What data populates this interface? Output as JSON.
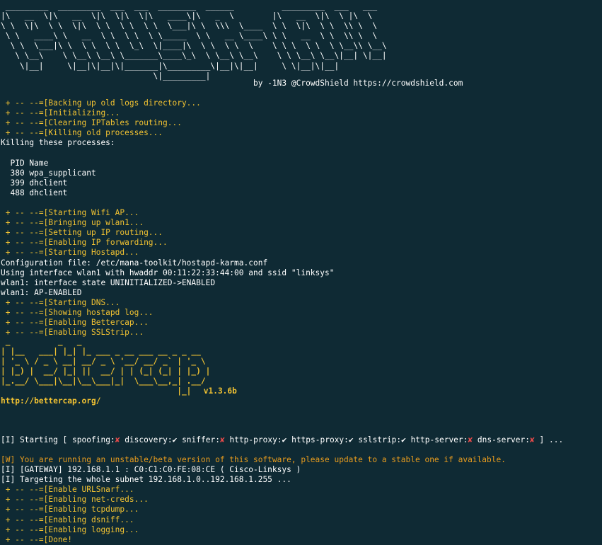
{
  "banner": [
    " _________  _________  ___  ___  ________  ______          _________  ___   ___",
    "|\\   __  \\|\\   __  \\|\\  \\|\\  \\|\\   ____\\|\\   _  \\        |\\   __  \\|\\  \\ |\\  \\",
    "\\ \\  \\|\\  \\ \\  \\|\\  \\ \\  \\ \\  \\ \\  \\___|\\ \\  \\\\\\  \\____  \\ \\  \\|\\  \\ \\  \\\\ \\  \\",
    " \\ \\   ____\\ \\   __  \\ \\  \\ \\  \\ \\_____  \\ \\   __ \\____\\ \\ \\   __  \\ \\  \\\\ \\  \\",
    "  \\ \\  \\___|\\ \\  \\ \\  \\ \\  \\_\\  \\|____|\\  \\ \\  \\ \\  \\    \\ \\ \\  \\ \\  \\ \\__\\\\ \\__\\",
    "   \\ \\__\\    \\ \\__\\ \\__\\ \\_______\\____\\_\\  \\ \\__\\ \\__\\    \\ \\ \\__\\ \\__\\|__| \\|__|",
    "    \\|__|     \\|__|\\|__|\\|_______|\\_________\\|__|\\|__|     \\ \\|__|\\|__|    ",
    "                                \\|_________|                  "
  ],
  "byline": "                                                     by -1N3 @CrowdShield https://crowdshield.com",
  "section1": [
    {
      "text": " + -- --=[Backing up old logs directory...",
      "style": "yellow"
    },
    {
      "text": " + -- --=[Initializing...",
      "style": "yellow"
    },
    {
      "text": " + -- --=[Clearing IPTables routing...",
      "style": "yellow"
    },
    {
      "text": " + -- --=[Killing old processes...",
      "style": "yellow"
    },
    {
      "text": "Killing these processes:",
      "style": "white"
    },
    {
      "text": "",
      "style": "white"
    },
    {
      "text": "  PID Name",
      "style": "white"
    },
    {
      "text": "  380 wpa_supplicant",
      "style": "white"
    },
    {
      "text": "  399 dhclient",
      "style": "white"
    },
    {
      "text": "  488 dhclient",
      "style": "white"
    },
    {
      "text": "",
      "style": "white"
    },
    {
      "text": " + -- --=[Starting Wifi AP...",
      "style": "yellow"
    },
    {
      "text": " + -- --=[Bringing up wlan1...",
      "style": "yellow"
    },
    {
      "text": " + -- --=[Setting up IP routing...",
      "style": "yellow"
    },
    {
      "text": " + -- --=[Enabling IP forwarding...",
      "style": "yellow"
    },
    {
      "text": " + -- --=[Starting Hostapd...",
      "style": "yellow"
    },
    {
      "text": "Configuration file: /etc/mana-toolkit/hostapd-karma.conf",
      "style": "white"
    },
    {
      "text": "Using interface wlan1 with hwaddr 00:11:22:33:44:00 and ssid \"linksys\"",
      "style": "white"
    },
    {
      "text": "wlan1: interface state UNINITIALIZED->ENABLED",
      "style": "white"
    },
    {
      "text": "wlan1: AP-ENABLED",
      "style": "white"
    },
    {
      "text": " + -- --=[Starting DNS...",
      "style": "yellow"
    },
    {
      "text": " + -- --=[Showing hostapd log...",
      "style": "yellow"
    },
    {
      "text": " + -- --=[Enabling Bettercap...",
      "style": "yellow"
    },
    {
      "text": " + -- --=[Enabling SSLStrip...",
      "style": "yellow"
    }
  ],
  "logo": [
    " _          _   _",
    "| |__   ___| |_| |_ ___ _ __ ___ __ _ _ __",
    "| '_ \\ / _ \\ __| __/ _ \\ '__/ __/ _` | '_ \\",
    "| |_) |  __/ |_| ||  __/ | | (_| (_| | |_) |",
    "|_.__/ \\___|\\__|\\__\\___|_|  \\___\\__,_| .__/",
    "                                     |_|"
  ],
  "version": " v1.3.6b",
  "url": "http://bettercap.org/",
  "status": {
    "prefix": "[I] Starting [ ",
    "items": [
      {
        "name": "spoofing",
        "mark": "✘",
        "on": false
      },
      {
        "name": "discovery",
        "mark": "✔",
        "on": true
      },
      {
        "name": "sniffer",
        "mark": "✘",
        "on": false
      },
      {
        "name": "http-proxy",
        "mark": "✔",
        "on": true
      },
      {
        "name": "https-proxy",
        "mark": "✔",
        "on": true
      },
      {
        "name": "sslstrip",
        "mark": "✔",
        "on": true
      },
      {
        "name": "http-server",
        "mark": "✘",
        "on": false
      },
      {
        "name": "dns-server",
        "mark": "✘",
        "on": false
      }
    ],
    "suffix": " ] ..."
  },
  "section2": [
    {
      "text": "[W] You are running an unstable/beta version of this software, please update to a stable one if available.",
      "style": "orange"
    },
    {
      "text": "[I] [GATEWAY] 192.168.1.1 : C0:C1:C0:FE:08:CE ( Cisco-Linksys )",
      "style": "white"
    },
    {
      "text": "[I] Targeting the whole subnet 192.168.1.0..192.168.1.255 ...",
      "style": "white"
    },
    {
      "text": " + -- --=[Enable URLSnarf...",
      "style": "yellow"
    },
    {
      "text": " + -- --=[Enabling net-creds...",
      "style": "yellow"
    },
    {
      "text": " + -- --=[Enabling tcpdump...",
      "style": "yellow"
    },
    {
      "text": " + -- --=[Enabling dsniff...",
      "style": "yellow"
    },
    {
      "text": " + -- --=[Enabling logging...",
      "style": "yellow"
    },
    {
      "text": " + -- --=[Done!",
      "style": "yellow"
    }
  ],
  "colors": {
    "background": "#0f2a34",
    "info": "#f1c232",
    "warning": "#e89c1e",
    "error_mark": "#e84a4a",
    "text": "#ffffff"
  }
}
